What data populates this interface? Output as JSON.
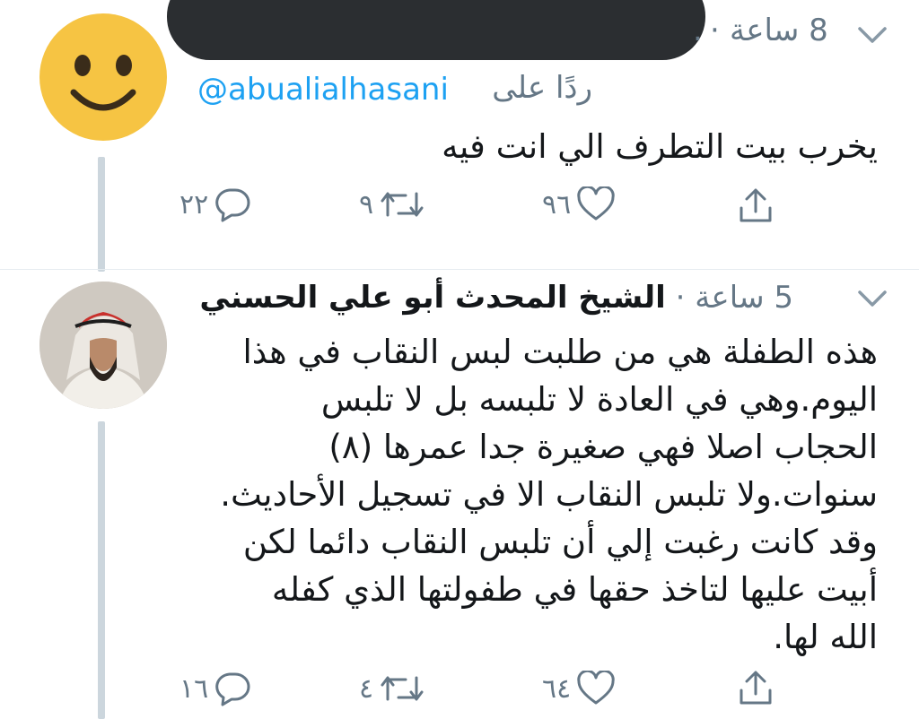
{
  "tweet1": {
    "time_label": "8 ساعة",
    "dot": "·",
    "name_fragment": ".",
    "reply_to_prefix": "ردًا على",
    "reply_to_handle": "@abualialhasani",
    "text": "يخرب بيت التطرف الي انت فيه",
    "actions": {
      "replies": "٢٢",
      "retweets": "٩",
      "likes": "٩٦"
    }
  },
  "tweet2": {
    "time_label": "5 ساعة",
    "dot": "·",
    "author_name": "الشيخ المحدث أبو علي الحسني",
    "text_lines": [
      "هذه الطفلة هي من طلبت لبس النقاب في هذا",
      "اليوم.وهي في العادة لا تلبسه بل لا تلبس",
      "الحجاب اصلا فهي صغيرة جدا عمرها (٨)",
      "سنوات.ولا تلبس النقاب الا في تسجيل الأحاديث.",
      "وقد كانت رغبت إلي أن تلبس النقاب دائما لكن",
      "أبيت عليها لتاخذ حقها في طفولتها الذي كفله",
      "الله لها."
    ],
    "actions": {
      "replies": "١٦",
      "retweets": "٤",
      "likes": "٦٤"
    }
  },
  "icons": [
    "smiley-avatar-icon",
    "chevron-down-icon",
    "reply-icon",
    "retweet-icon",
    "like-icon",
    "share-icon"
  ],
  "colors": {
    "accent": "#1da1f2",
    "muted": "#657786",
    "thread_line": "#ccd6dd",
    "redaction": "#2b2e31",
    "emoji_yellow": "#f6c443"
  }
}
